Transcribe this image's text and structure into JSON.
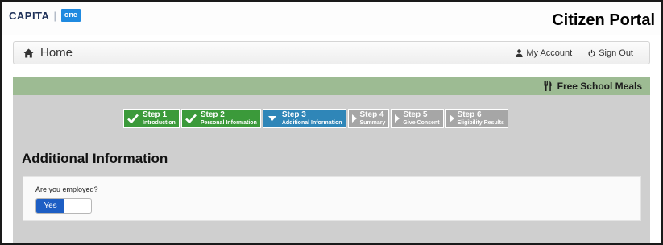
{
  "header": {
    "logo_brand": "CAPITA",
    "logo_separator": "|",
    "logo_badge": "one",
    "portal_title": "Citizen Portal"
  },
  "nav": {
    "home_label": "Home",
    "my_account_label": "My Account",
    "sign_out_label": "Sign Out"
  },
  "service": {
    "name": "Free School Meals"
  },
  "steps": [
    {
      "number": "Step 1",
      "label": "Introduction",
      "state": "done"
    },
    {
      "number": "Step 2",
      "label": "Personal Information",
      "state": "done"
    },
    {
      "number": "Step 3",
      "label": "Additional Information",
      "state": "current"
    },
    {
      "number": "Step 4",
      "label": "Summary",
      "state": "todo"
    },
    {
      "number": "Step 5",
      "label": "Give Consent",
      "state": "todo"
    },
    {
      "number": "Step 6",
      "label": "Eligibility Results",
      "state": "todo"
    }
  ],
  "page": {
    "heading": "Additional Information"
  },
  "form": {
    "employed_question": "Are you employed?",
    "employed_value": "Yes"
  },
  "colors": {
    "step_done": "#3b9a3a",
    "step_current": "#2f86b8",
    "step_todo": "#a6a6a6",
    "service_bar": "#9dbb93",
    "toggle_on": "#1d5ec4"
  },
  "icons": {
    "home": "home-icon",
    "account": "user-icon",
    "sign_out": "power-icon",
    "service": "fork-knife-icon"
  }
}
